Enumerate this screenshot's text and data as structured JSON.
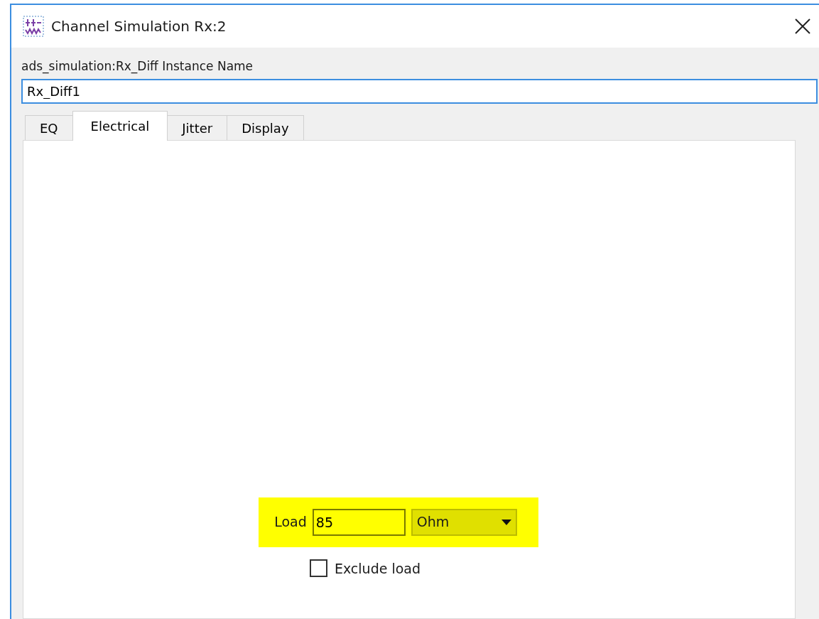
{
  "window": {
    "title": "Channel Simulation Rx:2"
  },
  "instance": {
    "label": "ads_simulation:Rx_Diff Instance Name",
    "value": "Rx_Diff1"
  },
  "tabs": [
    {
      "label": "EQ",
      "selected": false
    },
    {
      "label": "Electrical",
      "selected": true
    },
    {
      "label": "Jitter",
      "selected": false
    },
    {
      "label": "Display",
      "selected": false
    }
  ],
  "load": {
    "label": "Load",
    "value": "85",
    "unit": "Ohm",
    "highlighted": true
  },
  "exclude_load": {
    "label": "Exclude load",
    "checked": false
  }
}
